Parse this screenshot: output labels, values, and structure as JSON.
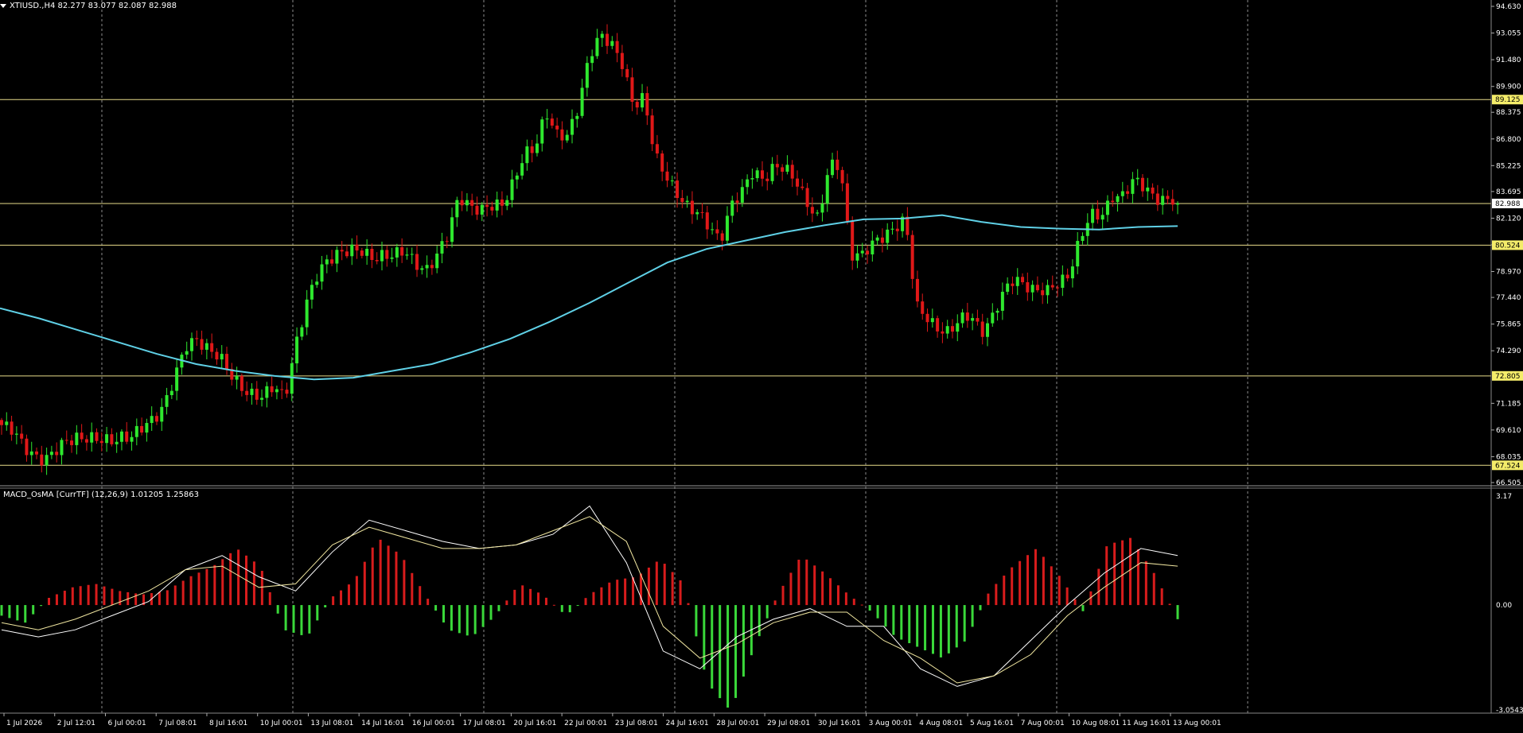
{
  "header": {
    "symbol_info": "XTIUSD.,H4  82.277 83.077 82.087 82.988",
    "indicator_info": "MACD_OsMA [CurrTF] (12,26,9) 1.01205 1.25863"
  },
  "colors": {
    "background": "#000000",
    "bull": "#2ee82e",
    "bear": "#e01818",
    "ma": "#5fd0e6",
    "level": "#e8dc8a",
    "axis_text": "#ffffff",
    "grid": "#c8c8c8",
    "macd_line": "#ffffff",
    "signal_line": "#f0e6a0",
    "hist_pos": "#d81c1c",
    "hist_neg": "#3ad83a",
    "tag_bg": "#f4ec6a",
    "tag_text": "#000000"
  },
  "chart_data": [
    {
      "type": "candlestick",
      "title": "XTIUSD.,H4",
      "ylim": [
        66.505,
        94.63
      ],
      "y_ticks": [
        "94.630",
        "93.055",
        "91.480",
        "89.900",
        "88.375",
        "86.800",
        "85.225",
        "83.695",
        "82.120",
        "80.545",
        "78.970",
        "77.440",
        "75.865",
        "74.290",
        "71.185",
        "69.610",
        "68.035",
        "66.505"
      ],
      "x_labels": [
        "1 Jul 2026",
        "2 Jul 12:01",
        "6 Jul 00:01",
        "7 Jul 08:01",
        "8 Jul 16:01",
        "10 Jul 00:01",
        "13 Jul 08:01",
        "14 Jul 16:01",
        "16 Jul 00:01",
        "17 Jul 08:01",
        "20 Jul 16:01",
        "22 Jul 00:01",
        "23 Jul 08:01",
        "24 Jul 16:01",
        "28 Jul 00:01",
        "29 Jul 08:01",
        "30 Jul 16:01",
        "3 Aug 00:01",
        "4 Aug 08:01",
        "5 Aug 16:01",
        "7 Aug 00:01",
        "10 Aug 08:01",
        "11 Aug 16:01",
        "13 Aug 00:01"
      ],
      "levels": [
        {
          "value": 89.125,
          "label": "89.125"
        },
        {
          "value": 82.988,
          "label": "82.988"
        },
        {
          "value": 80.524,
          "label": "80.524"
        },
        {
          "value": 72.805,
          "label": "72.805"
        },
        {
          "value": 67.524,
          "label": "67.524"
        }
      ],
      "price_path": [
        69.9,
        69.4,
        68.7,
        68.3,
        67.8,
        68.2,
        69.0,
        69.4,
        69.1,
        68.8,
        69.0,
        69.4,
        69.2,
        69.6,
        70.3,
        71.4,
        72.9,
        74.4,
        75.0,
        74.6,
        73.9,
        72.7,
        72.2,
        71.9,
        71.5,
        72.0,
        71.6,
        74.8,
        77.0,
        78.6,
        79.8,
        80.3,
        80.1,
        80.0,
        79.9,
        80.1,
        79.8,
        80.0,
        79.6,
        79.2,
        79.8,
        81.0,
        83.6,
        83.0,
        82.4,
        82.7,
        83.1,
        84.4,
        85.7,
        86.1,
        88.6,
        87.2,
        86.8,
        88.6,
        92.0,
        93.1,
        92.2,
        91.1,
        89.0,
        89.4,
        85.6,
        84.5,
        83.8,
        82.9,
        82.2,
        81.5,
        81.0,
        83.0,
        83.5,
        84.8,
        84.6,
        85.3,
        84.8,
        84.2,
        83.2,
        82.1,
        85.0,
        85.2,
        80.2,
        80.0,
        80.4,
        81.0,
        81.8,
        82.1,
        76.7,
        76.2,
        75.8,
        75.4,
        75.9,
        76.4,
        75.6,
        76.3,
        77.5,
        78.6,
        78.4,
        77.8,
        77.6,
        78.3,
        79.0,
        80.8,
        82.1,
        82.3,
        83.6,
        83.4,
        84.2,
        84.0,
        83.5,
        83.1,
        82.988
      ],
      "ma_path": [
        76.8,
        76.2,
        75.5,
        74.8,
        74.1,
        73.5,
        73.1,
        72.8,
        72.6,
        72.7,
        73.1,
        73.5,
        74.2,
        75.0,
        76.0,
        77.1,
        78.3,
        79.5,
        80.3,
        80.8,
        81.3,
        81.7,
        82.05,
        82.1,
        82.3,
        81.9,
        81.6,
        81.5,
        81.45,
        81.6,
        81.65
      ]
    },
    {
      "type": "bar",
      "title": "MACD_OsMA [CurrTF] (12,26,9)",
      "ylim": [
        -3.05431,
        3.17
      ],
      "y_ticks": [
        "3.17",
        "0.00",
        "-3.05431"
      ],
      "histogram": [
        -0.3,
        -0.5,
        0.2,
        0.5,
        0.6,
        0.4,
        0.3,
        0.4,
        0.8,
        1.1,
        1.6,
        1.1,
        -0.7,
        -0.9,
        0.2,
        0.7,
        1.9,
        1.4,
        0.3,
        -0.7,
        -0.9,
        -0.3,
        0.6,
        0.3,
        -0.3,
        0.3,
        0.7,
        0.8,
        1.3,
        0.6,
        -2.2,
        -3.0,
        -1.2,
        0.3,
        1.4,
        0.9,
        0.3,
        -0.2,
        -0.9,
        -1.2,
        -1.5,
        -1.0,
        0.4,
        1.1,
        1.6,
        0.8,
        -0.2,
        1.7,
        1.9,
        0.9,
        -0.4
      ],
      "macd_path": [
        -0.7,
        -0.9,
        -0.7,
        -0.3,
        0.1,
        1.0,
        1.4,
        0.8,
        0.4,
        1.5,
        2.4,
        2.1,
        1.8,
        1.6,
        1.7,
        2.0,
        2.8,
        1.2,
        -1.3,
        -1.8,
        -0.9,
        -0.4,
        -0.1,
        -0.6,
        -0.6,
        -1.8,
        -2.3,
        -2.0,
        -1.0,
        0.0,
        0.9,
        1.6,
        1.4
      ],
      "signal_path": [
        -0.5,
        -0.7,
        -0.4,
        0.0,
        0.4,
        1.0,
        1.1,
        0.5,
        0.6,
        1.7,
        2.2,
        1.9,
        1.6,
        1.6,
        1.7,
        2.1,
        2.5,
        1.8,
        -0.6,
        -1.5,
        -1.1,
        -0.5,
        -0.2,
        -0.2,
        -1.0,
        -1.5,
        -2.2,
        -2.0,
        -1.4,
        -0.3,
        0.5,
        1.2,
        1.1
      ]
    }
  ]
}
